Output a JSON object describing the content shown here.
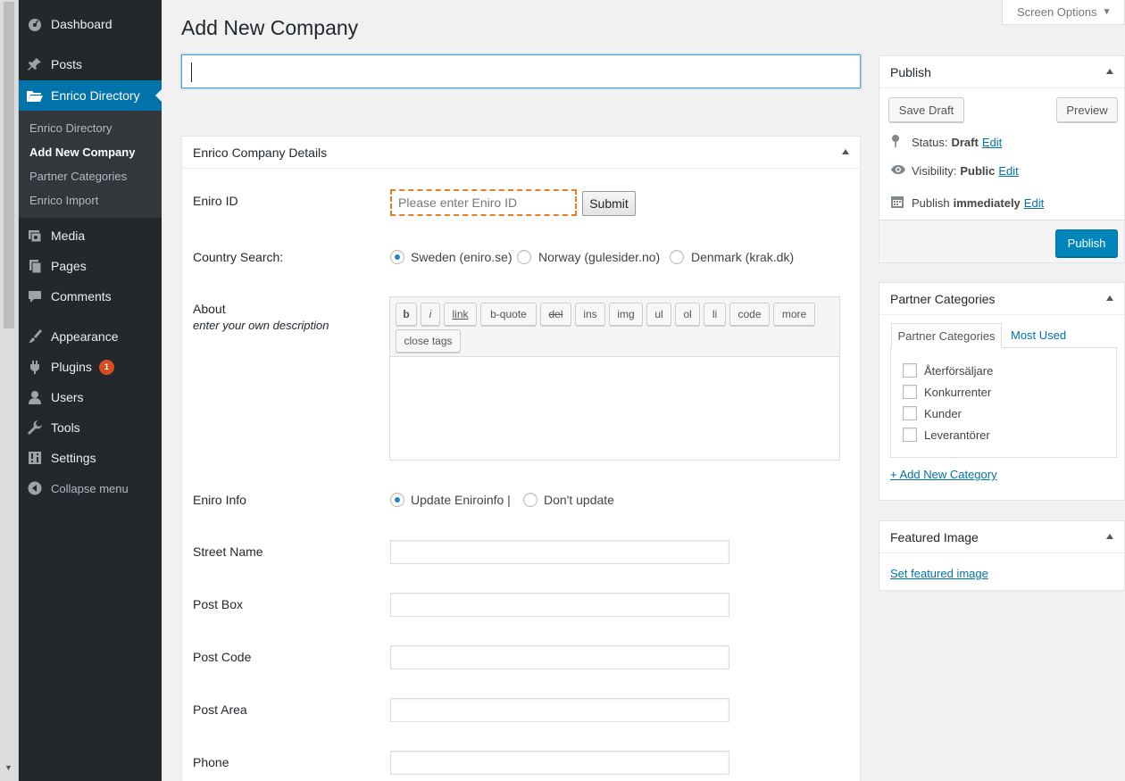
{
  "menu": {
    "dashboard": "Dashboard",
    "posts": "Posts",
    "enrico_directory": "Enrico Directory",
    "submenu": [
      "Enrico Directory",
      "Add New Company",
      "Partner Categories",
      "Enrico Import"
    ],
    "media": "Media",
    "pages": "Pages",
    "comments": "Comments",
    "appearance": "Appearance",
    "plugins": "Plugins",
    "plugins_badge": "1",
    "users": "Users",
    "tools": "Tools",
    "settings": "Settings",
    "collapse": "Collapse menu"
  },
  "header": {
    "title": "Add New Company",
    "screen_options": "Screen Options"
  },
  "details": {
    "title": "Enrico Company Details",
    "eniro_id_label": "Eniro ID",
    "eniro_id_placeholder": "Please enter Eniro ID",
    "submit": "Submit",
    "country_label": "Country Search:",
    "countries": [
      "Sweden (eniro.se)",
      "Norway (gulesider.no)",
      "Denmark (krak.dk)"
    ],
    "about_label": "About",
    "about_sub": "enter your own description",
    "quicktags": [
      "b",
      "i",
      "link",
      "b-quote",
      "del",
      "ins",
      "img",
      "ul",
      "ol",
      "li",
      "code",
      "more",
      "close tags"
    ],
    "eniro_info_label": "Eniro Info",
    "update_info": "Update Eniroinfo |",
    "dont_update": "Don't update",
    "fields": [
      "Street Name",
      "Post Box",
      "Post Code",
      "Post Area",
      "Phone"
    ]
  },
  "publish": {
    "title": "Publish",
    "save_draft": "Save Draft",
    "preview": "Preview",
    "status_label": "Status:",
    "status_value": "Draft",
    "visibility_label": "Visibility:",
    "visibility_value": "Public",
    "publish_label": "Publish",
    "publish_value": "immediately",
    "edit": "Edit",
    "publish_button": "Publish"
  },
  "partner": {
    "title": "Partner Categories",
    "tab_all": "Partner Categories",
    "tab_used": "Most Used",
    "categories": [
      "Återförsäljare",
      "Konkurrenter",
      "Kunder",
      "Leverantörer"
    ],
    "add_new": "+ Add New Category"
  },
  "featured": {
    "title": "Featured Image",
    "set": "Set featured image"
  },
  "colors": {
    "admin_bg": "#23282d",
    "accent": "#0073aa",
    "highlight": "#e67e22"
  }
}
